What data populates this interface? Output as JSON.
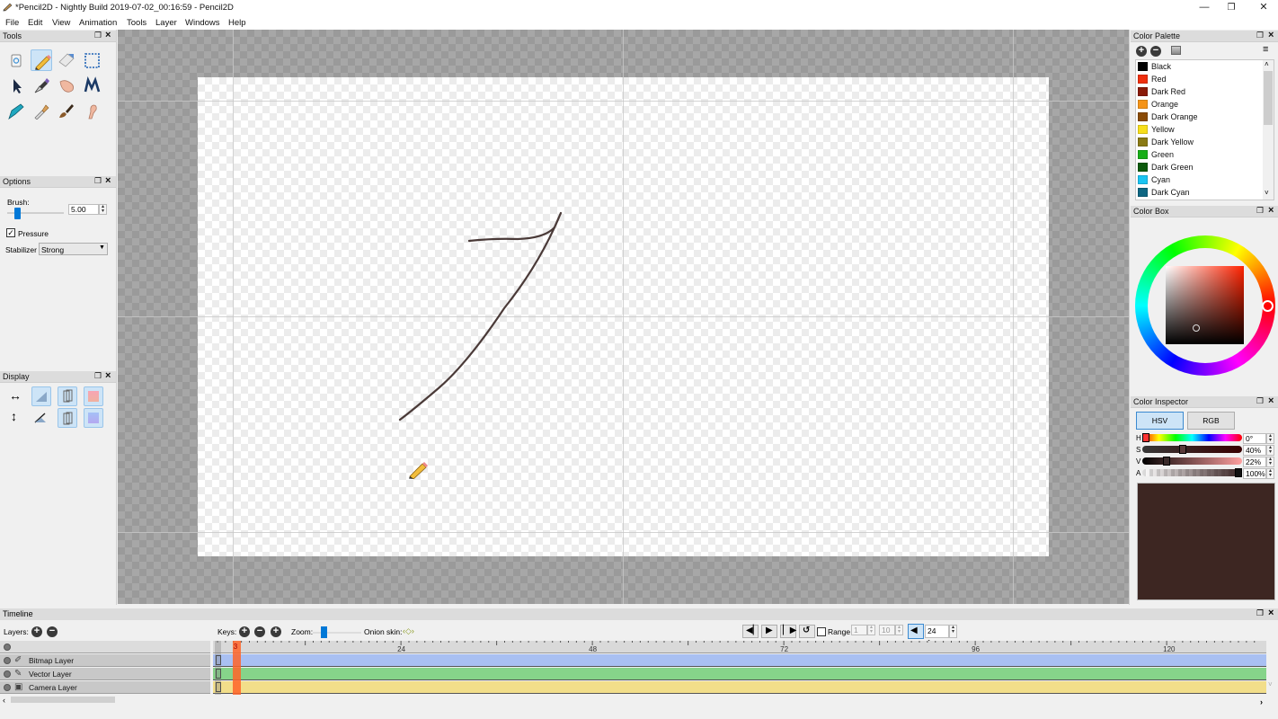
{
  "window": {
    "title": "*Pencil2D - Nightly Build 2019-07-02_00:16:59 - Pencil2D",
    "controls": {
      "minimize": "—",
      "maximize": "❐",
      "close": "✕"
    }
  },
  "menu": [
    "File",
    "Edit",
    "View",
    "Animation",
    "Tools",
    "Layer",
    "Windows",
    "Help"
  ],
  "panels": {
    "tools": {
      "title": "Tools",
      "items": [
        {
          "name": "clear",
          "icon": "trash-icon"
        },
        {
          "name": "pencil",
          "icon": "pencil-icon",
          "active": true
        },
        {
          "name": "eraser",
          "icon": "eraser-icon"
        },
        {
          "name": "select",
          "icon": "select-rect-icon"
        },
        {
          "name": "move",
          "icon": "move-arrow-icon"
        },
        {
          "name": "pen",
          "icon": "pen-nib-icon"
        },
        {
          "name": "hand",
          "icon": "hand-icon"
        },
        {
          "name": "polyline",
          "icon": "polyline-icon"
        },
        {
          "name": "bucket",
          "icon": "bucket-icon"
        },
        {
          "name": "eyedropper",
          "icon": "eyedropper-icon"
        },
        {
          "name": "brush",
          "icon": "brush-icon"
        },
        {
          "name": "smudge",
          "icon": "smudge-finger-icon"
        }
      ]
    },
    "options": {
      "title": "Options",
      "brush_label": "Brush:",
      "brush_value": "5.00",
      "brush_slider_fraction": 0.05,
      "pressure_label": "Pressure",
      "pressure_checked": true,
      "stabilizer_label": "Stabilizer",
      "stabilizer_value": "Strong"
    },
    "display": {
      "title": "Display",
      "items": [
        {
          "name": "flip-horizontal",
          "icon": "flip-horizontal-icon"
        },
        {
          "name": "onion-prev",
          "icon": "onion-previous-icon",
          "active": true
        },
        {
          "name": "onion-skin-1",
          "icon": "onion-frames-icon",
          "active": true
        },
        {
          "name": "onion-red",
          "icon": "onion-red-icon",
          "active": true
        },
        {
          "name": "flip-vertical",
          "icon": "flip-vertical-icon"
        },
        {
          "name": "onion-next",
          "icon": "onion-next-icon"
        },
        {
          "name": "onion-skin-2",
          "icon": "onion-frames-icon",
          "active": true
        },
        {
          "name": "onion-blue",
          "icon": "onion-blue-icon",
          "active": true
        }
      ]
    },
    "color_palette": {
      "title": "Color Palette",
      "colors": [
        {
          "name": "Black",
          "hex": "#000000"
        },
        {
          "name": "Red",
          "hex": "#f0300f"
        },
        {
          "name": "Dark Red",
          "hex": "#8a1a08"
        },
        {
          "name": "Orange",
          "hex": "#f59418"
        },
        {
          "name": "Dark Orange",
          "hex": "#8a4a05"
        },
        {
          "name": "Yellow",
          "hex": "#f7de1a"
        },
        {
          "name": "Dark Yellow",
          "hex": "#8a7a14"
        },
        {
          "name": "Green",
          "hex": "#18ae18"
        },
        {
          "name": "Dark Green",
          "hex": "#0c5a0c"
        },
        {
          "name": "Cyan",
          "hex": "#1ac4f2"
        },
        {
          "name": "Dark Cyan",
          "hex": "#0e6682"
        }
      ]
    },
    "color_box": {
      "title": "Color Box"
    },
    "color_inspector": {
      "title": "Color Inspector",
      "tabs": [
        "HSV",
        "RGB"
      ],
      "active_tab": "HSV",
      "channels": [
        {
          "label": "H",
          "value": "0°",
          "fraction": 0.0
        },
        {
          "label": "S",
          "value": "40%",
          "fraction": 0.4
        },
        {
          "label": "V",
          "value": "22%",
          "fraction": 0.22
        },
        {
          "label": "A",
          "value": "100%",
          "fraction": 1.0
        }
      ],
      "current_color": "#3d2622"
    }
  },
  "timeline": {
    "title": "Timeline",
    "layers_label": "Layers:",
    "keys_label": "Keys:",
    "zoom_label": "Zoom:",
    "onion_skin_label": "Onion skin:",
    "range_label": "Range",
    "range_checked": false,
    "range_start": "1",
    "range_end": "10",
    "fps": "24 fps",
    "current_frame": "3",
    "ruler_labels": [
      "24",
      "48",
      "72",
      "96",
      "120"
    ],
    "layers": [
      {
        "name": "Bitmap Layer",
        "type": "bitmap",
        "color": "#a9c0f2"
      },
      {
        "name": "Vector Layer",
        "type": "vector",
        "color": "#86d48a"
      },
      {
        "name": "Camera Layer",
        "type": "camera",
        "color": "#f2de8a"
      }
    ]
  }
}
